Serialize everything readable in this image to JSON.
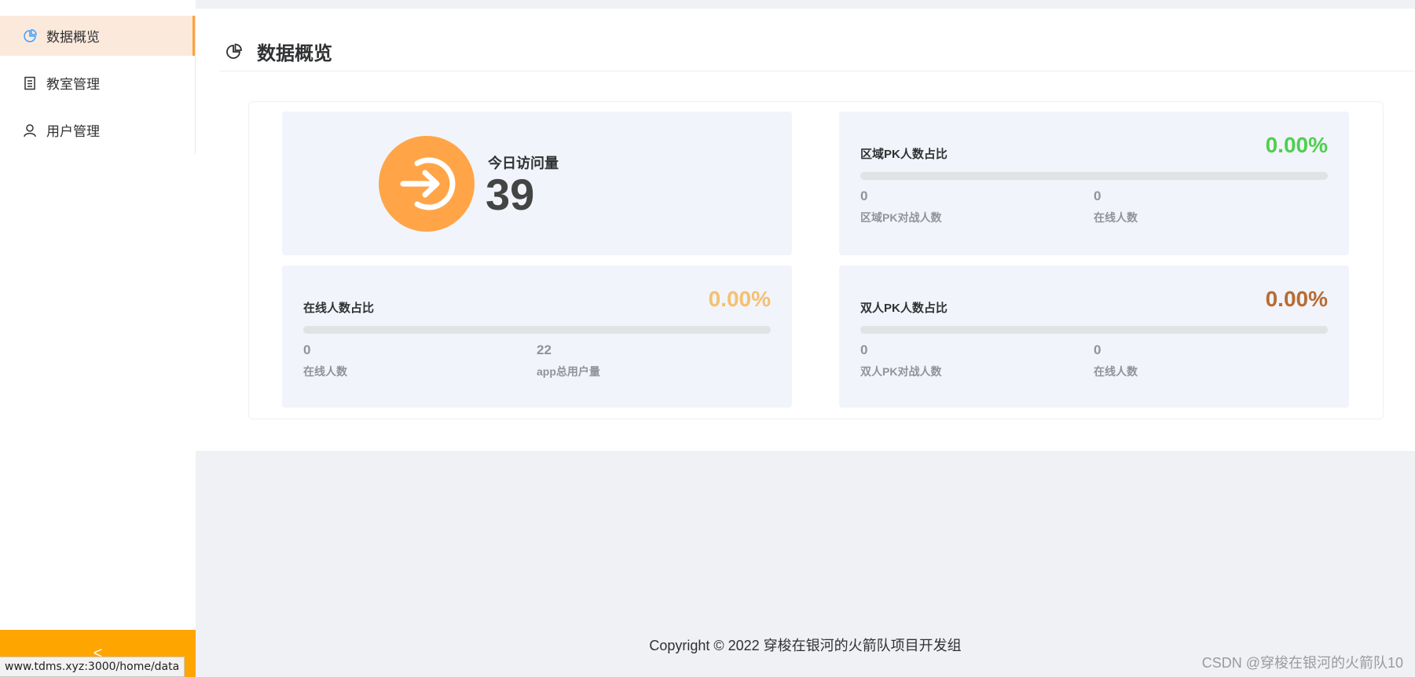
{
  "sidebar": {
    "items": [
      {
        "label": "数据概览",
        "icon": "pie-chart-icon",
        "active": true
      },
      {
        "label": "教室管理",
        "icon": "document-icon",
        "active": false
      },
      {
        "label": "用户管理",
        "icon": "user-icon",
        "active": false
      }
    ],
    "collapse_glyph": "<"
  },
  "status_bar": {
    "url": "www.tdms.xyz:3000/home/data"
  },
  "page": {
    "title": "数据概览",
    "icon": "pie-chart-icon"
  },
  "visits": {
    "label": "今日访问量",
    "value": "39",
    "icon": "login-arrow-icon"
  },
  "cards": {
    "region_pk": {
      "title": "区域PK人数占比",
      "percent": "0.00%",
      "progress": 0,
      "color": "#4fcf4f",
      "stats": [
        {
          "value": "0",
          "label": "区域PK对战人数"
        },
        {
          "value": "0",
          "label": "在线人数"
        }
      ]
    },
    "online": {
      "title": "在线人数占比",
      "percent": "0.00%",
      "progress": 0,
      "color": "#f5c071",
      "stats": [
        {
          "value": "0",
          "label": "在线人数"
        },
        {
          "value": "22",
          "label": "app总用户量"
        }
      ]
    },
    "duo_pk": {
      "title": "双人PK人数占比",
      "percent": "0.00%",
      "progress": 0,
      "color": "#b96b32",
      "stats": [
        {
          "value": "0",
          "label": "双人PK对战人数"
        },
        {
          "value": "0",
          "label": "在线人数"
        }
      ]
    }
  },
  "footer": {
    "copyright": "Copyright © 2022 穿梭在银河的火箭队项目开发组"
  },
  "watermark": "CSDN @穿梭在银河的火箭队10",
  "colors": {
    "accent": "#ffa500",
    "visit_circle": "#ffa548",
    "active_bg": "#fbe9dc"
  }
}
